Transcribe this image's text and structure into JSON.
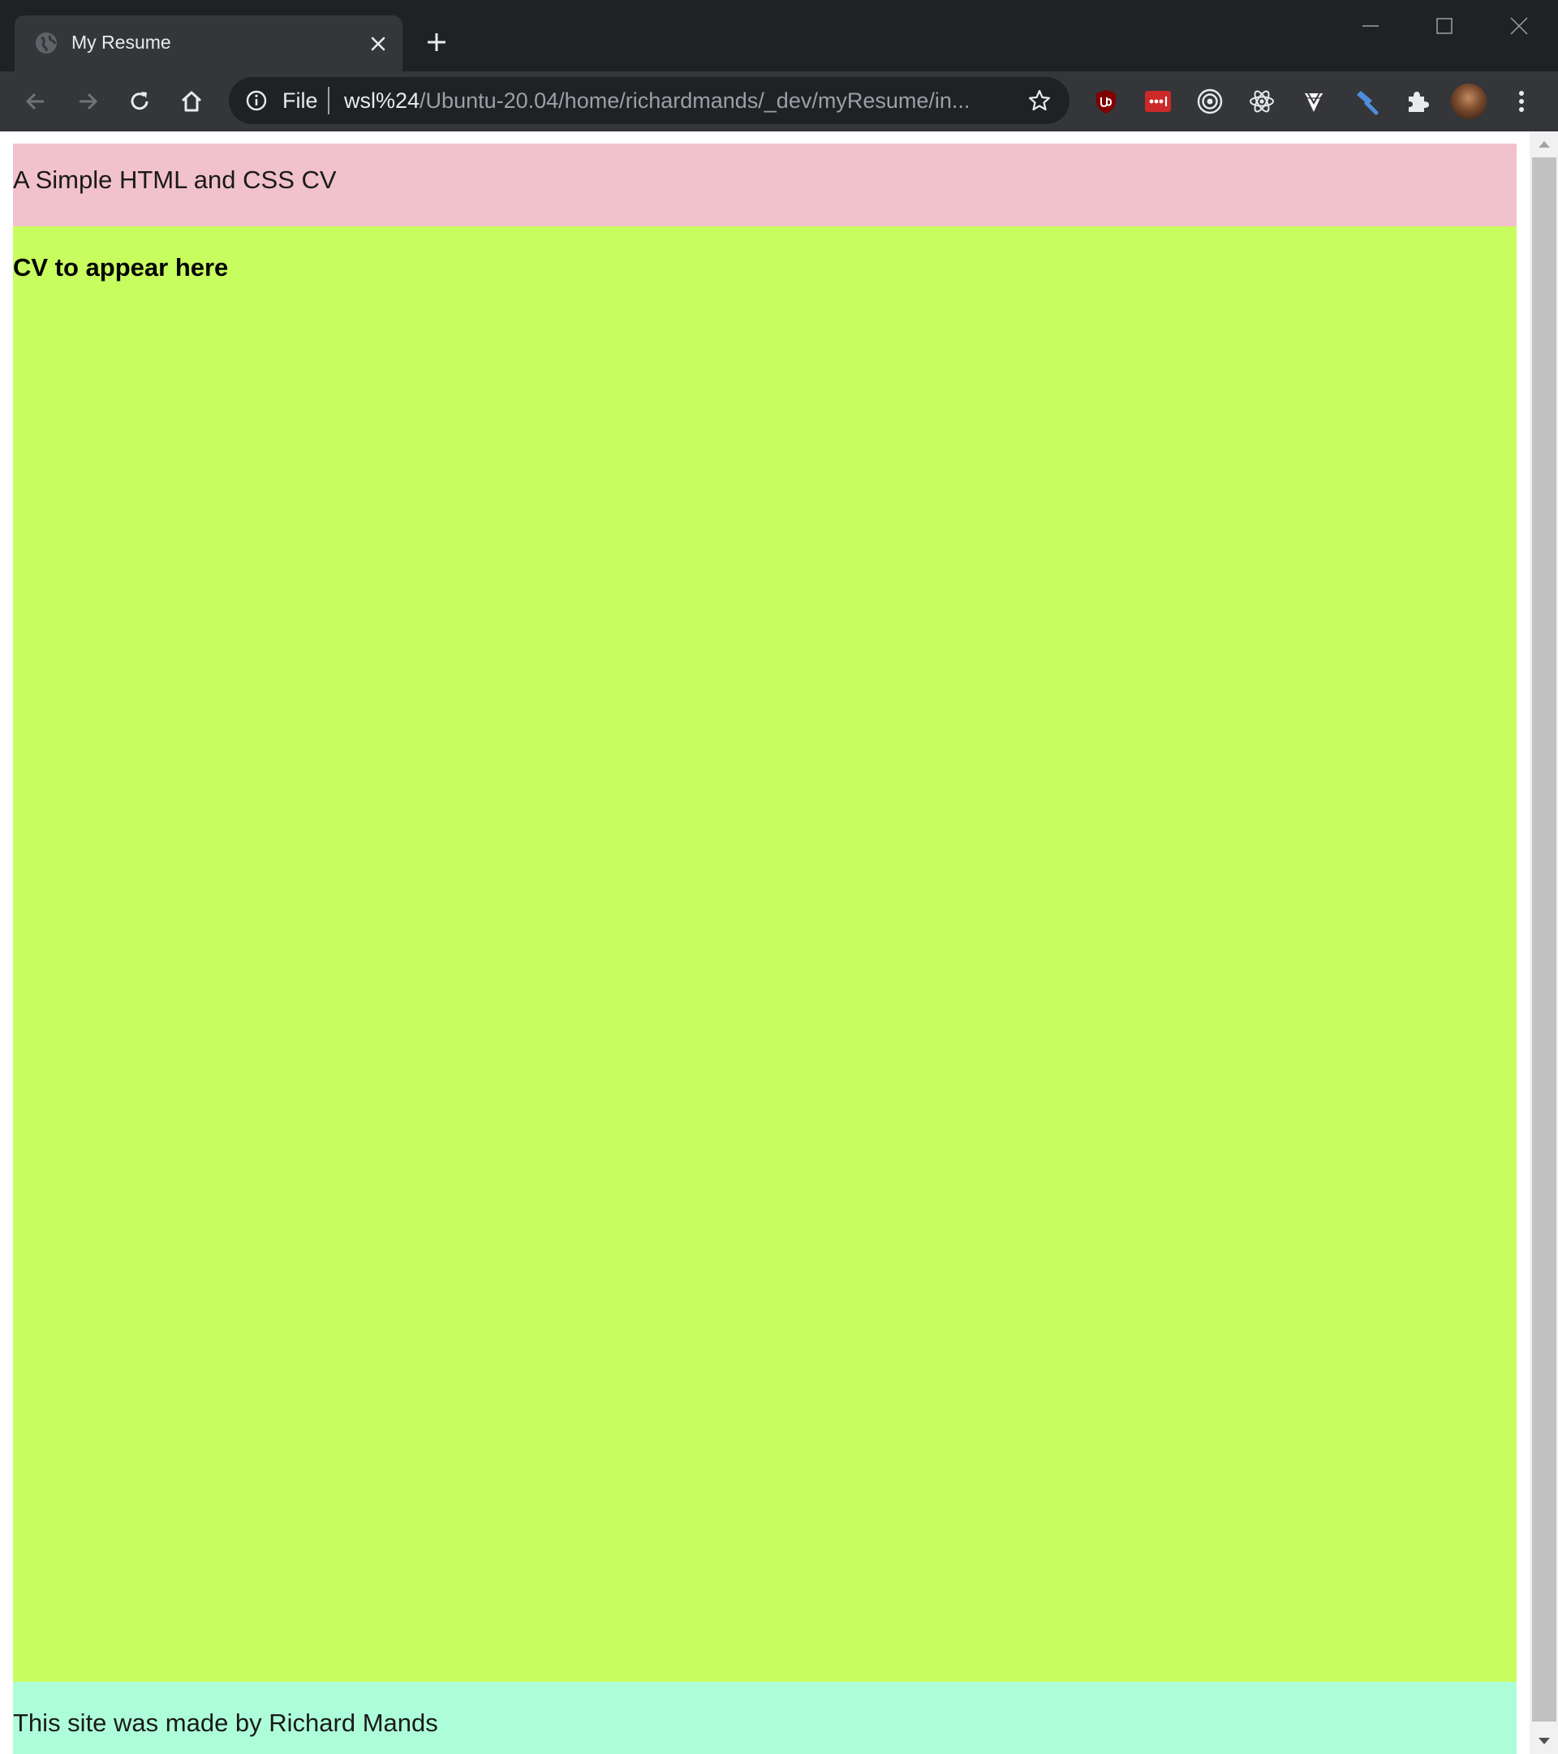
{
  "tab": {
    "title": "My Resume"
  },
  "omnibox": {
    "scheme_label": "File",
    "url_host": "wsl%24",
    "url_path": "/Ubuntu-20.04/home/richardmands/_dev/myResume/in..."
  },
  "page": {
    "header_title": "A Simple HTML and CSS CV",
    "main_heading": "CV to appear here",
    "footer_text": "This site was made by Richard Mands"
  },
  "colors": {
    "titlebar": "#202124",
    "toolbar": "#35363a",
    "header_bg": "#f1c2cb",
    "main_bg": "#c8fd5f",
    "footer_bg": "#adfed8"
  },
  "icons": {
    "extensions": [
      "ublock-origin-icon",
      "lastpass-icon",
      "target-icon",
      "react-devtools-icon",
      "vue-devtools-icon",
      "hammer-icon",
      "extensions-puzzle-icon"
    ]
  }
}
